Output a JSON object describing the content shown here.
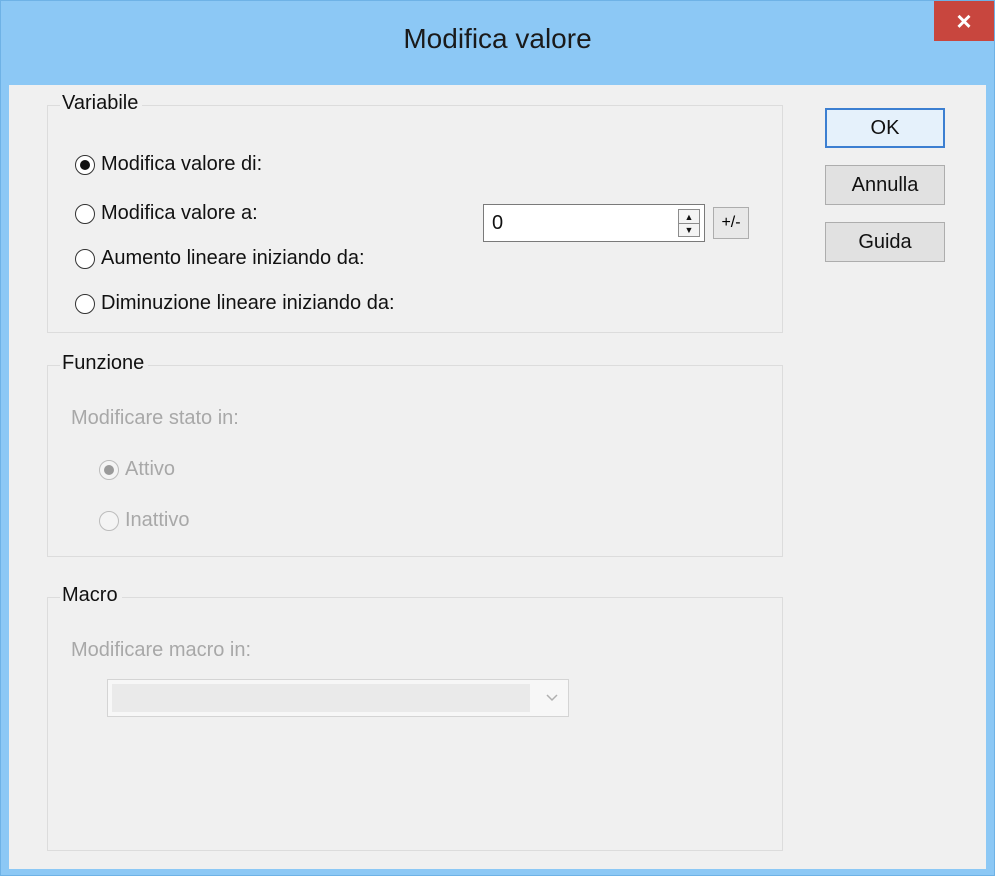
{
  "window": {
    "title": "Modifica valore",
    "close_label": "×"
  },
  "buttons": {
    "ok": "OK",
    "cancel": "Annulla",
    "help": "Guida"
  },
  "variabile": {
    "label": "Variabile",
    "options": [
      {
        "label": "Modifica valore di:",
        "selected": true
      },
      {
        "label": "Modifica valore a:",
        "selected": false
      },
      {
        "label": "Aumento lineare iniziando da:",
        "selected": false
      },
      {
        "label": "Diminuzione lineare iniziando da:",
        "selected": false
      }
    ],
    "value": "0",
    "plusminus_label": "+/-"
  },
  "funzione": {
    "label": "Funzione",
    "subtitle": "Modificare stato in:",
    "options": [
      {
        "label": "Attivo",
        "selected": true
      },
      {
        "label": "Inattivo",
        "selected": false
      }
    ]
  },
  "macro": {
    "label": "Macro",
    "subtitle": "Modificare macro in:",
    "selected": ""
  },
  "colors": {
    "titlebar": "#8cc8f5",
    "close": "#c8463e",
    "client": "#f0f0f0"
  }
}
